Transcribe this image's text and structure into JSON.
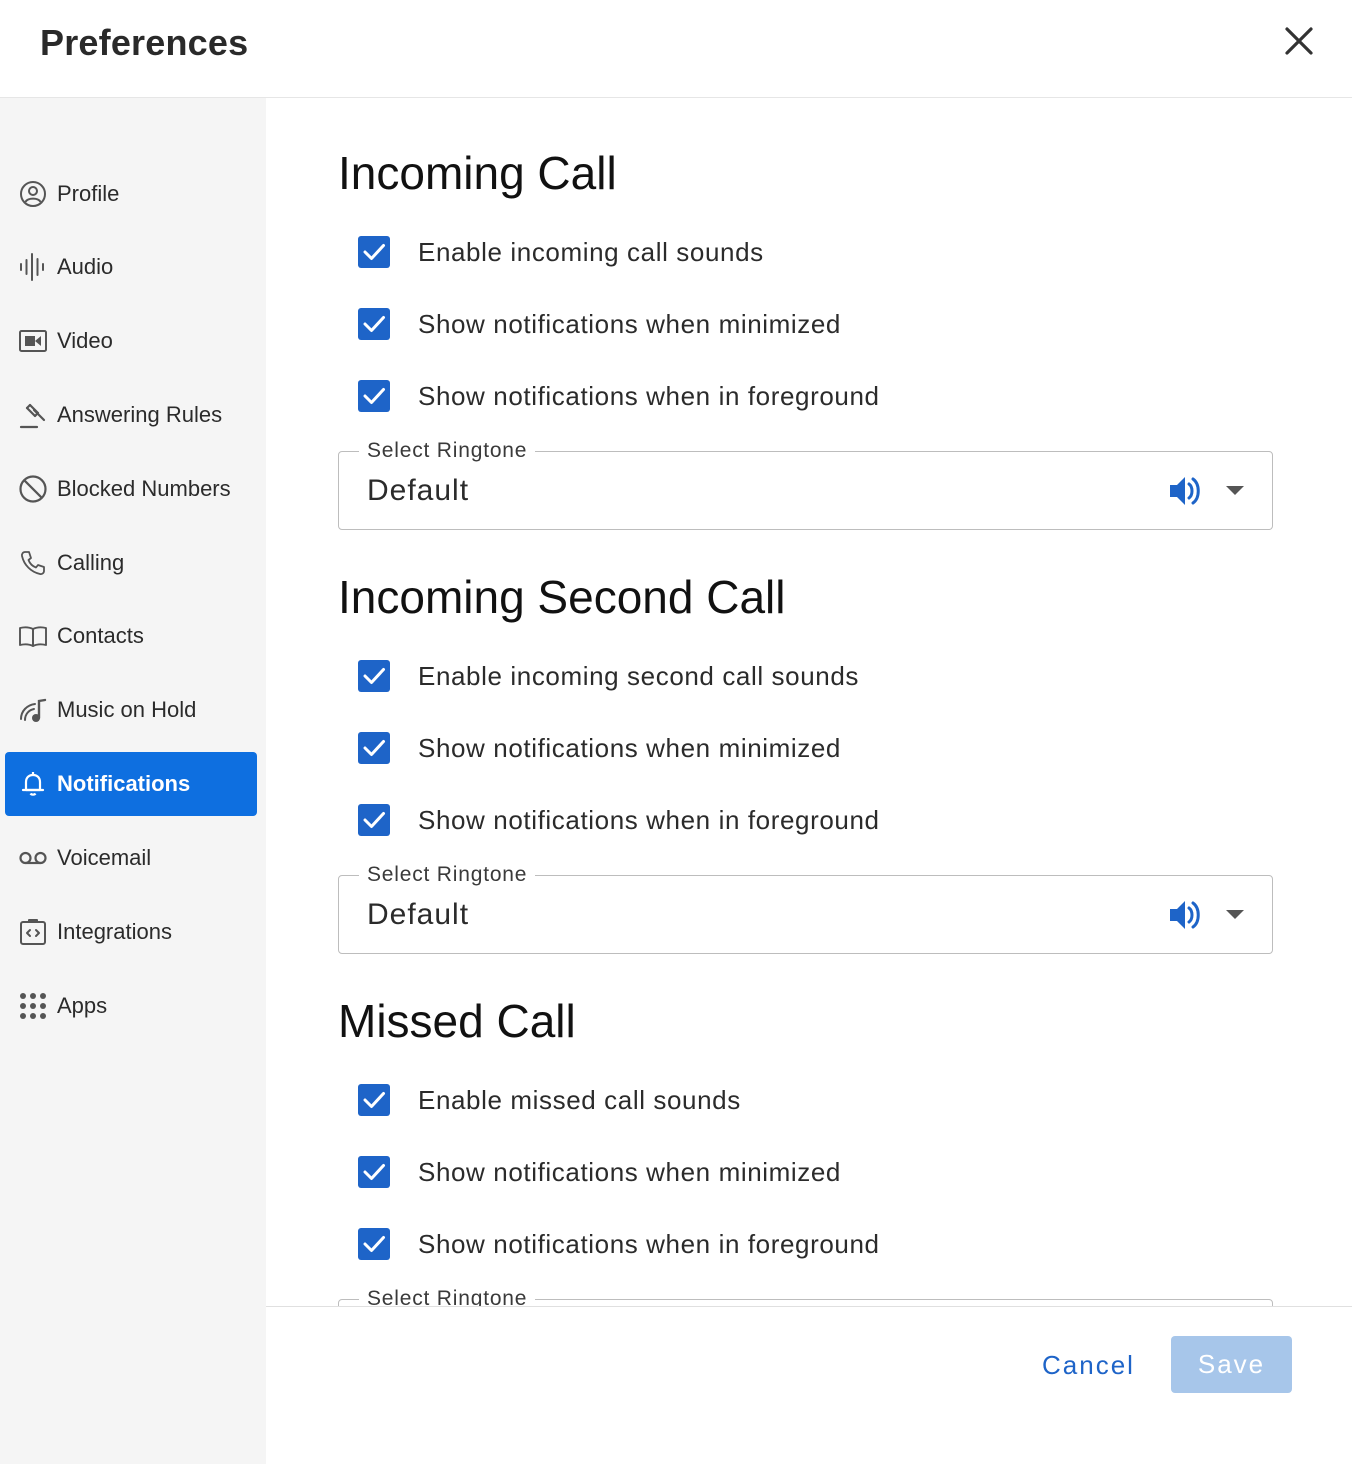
{
  "header": {
    "title": "Preferences"
  },
  "sidebar": {
    "items": [
      {
        "label": "Profile",
        "icon": "profile-icon"
      },
      {
        "label": "Audio",
        "icon": "audio-waveform-icon"
      },
      {
        "label": "Video",
        "icon": "video-camera-icon"
      },
      {
        "label": "Answering Rules",
        "icon": "gavel-icon"
      },
      {
        "label": "Blocked Numbers",
        "icon": "block-icon"
      },
      {
        "label": "Calling",
        "icon": "phone-icon"
      },
      {
        "label": "Contacts",
        "icon": "book-icon"
      },
      {
        "label": "Music on Hold",
        "icon": "music-note-icon"
      },
      {
        "label": "Notifications",
        "icon": "bell-icon",
        "active": true
      },
      {
        "label": "Voicemail",
        "icon": "voicemail-icon"
      },
      {
        "label": "Integrations",
        "icon": "integration-icon"
      },
      {
        "label": "Apps",
        "icon": "apps-grid-icon"
      }
    ]
  },
  "sections": [
    {
      "title": "Incoming Call",
      "options": [
        {
          "label": "Enable incoming call sounds",
          "checked": true
        },
        {
          "label": "Show notifications when minimized",
          "checked": true
        },
        {
          "label": "Show notifications when in foreground",
          "checked": true
        }
      ],
      "ringtone": {
        "label": "Select Ringtone",
        "value": "Default"
      }
    },
    {
      "title": "Incoming Second Call",
      "options": [
        {
          "label": "Enable incoming second call sounds",
          "checked": true
        },
        {
          "label": "Show notifications when minimized",
          "checked": true
        },
        {
          "label": "Show notifications when in foreground",
          "checked": true
        }
      ],
      "ringtone": {
        "label": "Select Ringtone",
        "value": "Default"
      }
    },
    {
      "title": "Missed Call",
      "options": [
        {
          "label": "Enable missed call sounds",
          "checked": true
        },
        {
          "label": "Show notifications when minimized",
          "checked": true
        },
        {
          "label": "Show notifications when in foreground",
          "checked": true
        }
      ],
      "ringtone": {
        "label": "Select Ringtone",
        "value": ""
      }
    }
  ],
  "footer": {
    "cancel_label": "Cancel",
    "save_label": "Save"
  },
  "colors": {
    "accent": "#0e6fe0",
    "checkbox": "#1e64c8",
    "save_disabled": "#a7c6ea"
  }
}
